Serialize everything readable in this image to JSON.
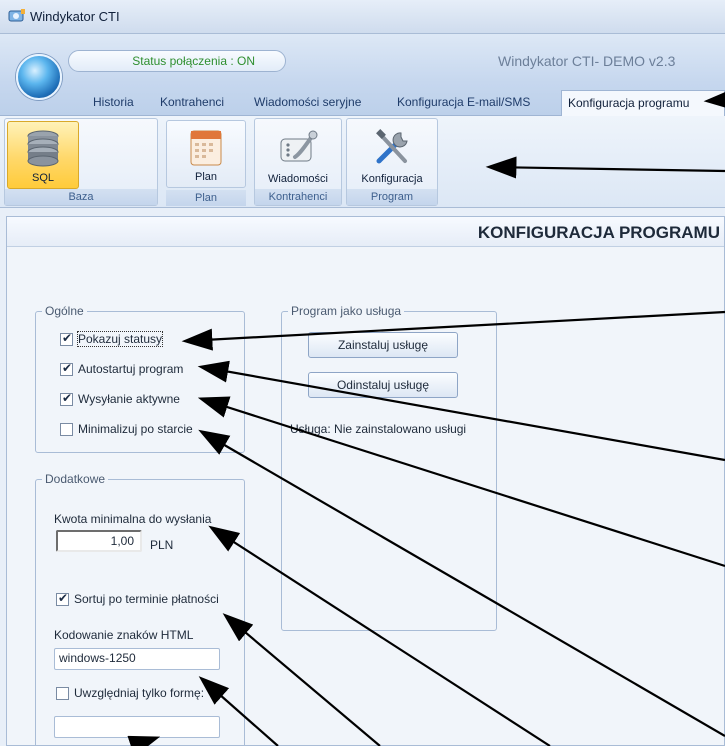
{
  "window": {
    "title": "Windykator CTI"
  },
  "header": {
    "status": "Status połączenia : ON",
    "app_title": "Windykator CTI- DEMO v2.3"
  },
  "tabs": [
    {
      "label": "Historia"
    },
    {
      "label": "Kontrahenci"
    },
    {
      "label": "Wiadomości seryjne"
    },
    {
      "label": "Konfiguracja E-mail/SMS"
    },
    {
      "label": "Konfiguracja programu",
      "active": true
    }
  ],
  "ribbon": {
    "groups": [
      {
        "label": "Baza",
        "button": "SQL",
        "selected": true,
        "icon": "database-icon"
      },
      {
        "label": "Plan",
        "button": "Plan",
        "icon": "calendar-icon"
      },
      {
        "label": "Kontrahenci",
        "button": "Wiadomości",
        "icon": "phone-icon"
      },
      {
        "label": "Program",
        "button": "Konfiguracja",
        "icon": "tools-icon"
      }
    ]
  },
  "section": {
    "title": "KONFIGURACJA PROGRAMU"
  },
  "general": {
    "legend": "Ogólne",
    "items": [
      {
        "label": "Pokazuj statusy",
        "checked": true
      },
      {
        "label": "Autostartuj program",
        "checked": true
      },
      {
        "label": "Wysyłanie aktywne",
        "checked": true
      },
      {
        "label": "Minimalizuj po starcie",
        "checked": false
      }
    ]
  },
  "service": {
    "legend": "Program jako usługa",
    "install": "Zainstaluj usługę",
    "uninstall": "Odinstaluj usługę",
    "status": "Usługa: Nie zainstalowano usługi"
  },
  "additional": {
    "legend": "Dodatkowe",
    "min_amount_label": "Kwota minimalna do wysłania",
    "min_amount_value": "1,00",
    "currency": "PLN",
    "sort_label": "Sortuj po terminie płatności",
    "sort_checked": true,
    "encoding_label": "Kodowanie znaków HTML",
    "encoding_value": "windows-1250",
    "form_only_label": "Uwzględniaj tylko formę:",
    "form_only_checked": false,
    "form_value": ""
  }
}
